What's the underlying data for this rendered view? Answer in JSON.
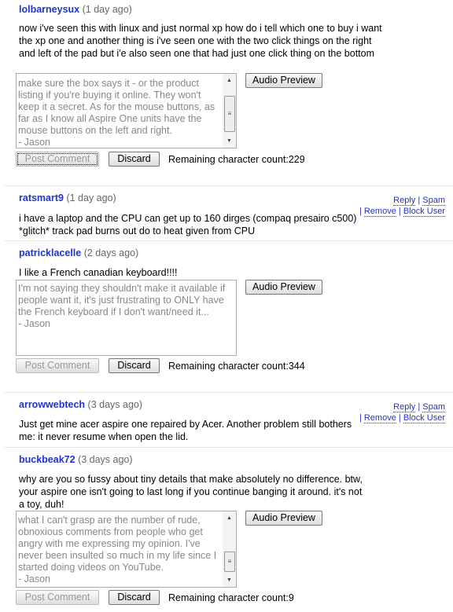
{
  "labels": {
    "audio_preview": "Audio Preview",
    "post_comment": "Post Comment",
    "discard": "Discard",
    "remaining": "Remaining character count:",
    "reply": "Reply",
    "spam": "Spam",
    "remove": "Remove",
    "block_user": "Block User"
  },
  "comments": [
    {
      "user": "lolbarneysux",
      "ago": "(1 day ago)",
      "body": "now i've seen this with linux and just normal xp how do i tell which one to buy i want the xp one and another thing is i've seen one with the two click things on the right and left of the pad but i'e also seen one that had just one click thing on the bottom",
      "reply_text": [
        "make sure the box says it - or the product",
        "listing if you're buying it online. They won't",
        "keep it a secret. As for the mouse buttons, as",
        "far as I know all Aspire One units have the",
        "mouse buttons on the left and right.",
        "- Jason"
      ],
      "remaining": "229"
    },
    {
      "user": "ratsmart9",
      "ago": "(1 day ago)",
      "body": "i have a laptop and the CPU can get up to 160 dirges (compaq presairo c500) *glitch* track pad burns out do to heat given from CPU"
    },
    {
      "user": "patricklacelle",
      "ago": "(2 days ago)",
      "body": "I like a French canadian keyboard!!!!",
      "reply_text": [
        "I'm not saying they shouldn't make it available if",
        "people want it, it's just frustrating to ONLY have",
        "the French keyboard if I don't want/need it...",
        "- Jason"
      ],
      "remaining": "344"
    },
    {
      "user": "arrowwebtech",
      "ago": "(3 days ago)",
      "body": "Just get mine acer aspire one repaired by Acer. Another problem still bothers me: it never resume when open the lid."
    },
    {
      "user": "buckbeak72",
      "ago": "(3 days ago)",
      "body": "why are you so fussy about tiny details that make absolutely no difference. btw, your aspire one isn't going to last long if you continue banging it around. it's not a toy, duh!",
      "reply_text": [
        "what I can't grasp are the number of rude,",
        "obnoxious comments from people who get",
        "angry with me expressing my opinion. I've",
        "never been insulted so much in my life since I",
        "started doing videos on YouTube.",
        "- Jason"
      ],
      "remaining": "9"
    }
  ]
}
